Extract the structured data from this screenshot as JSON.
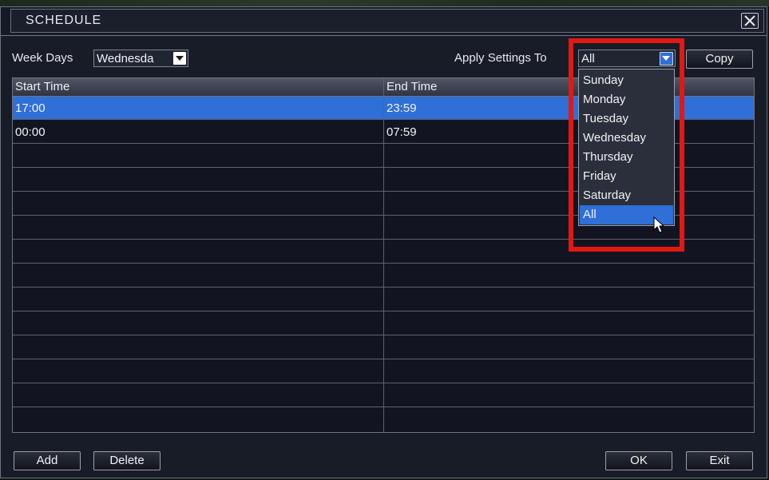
{
  "window": {
    "title": "SCHEDULE"
  },
  "controls": {
    "week_days_label": "Week Days",
    "week_days_value": "Wednesda",
    "apply_label": "Apply Settings To",
    "apply_value": "All",
    "copy_label": "Copy"
  },
  "table": {
    "headers": [
      "Start Time",
      "End Time"
    ],
    "rows": [
      {
        "start": "17:00",
        "end": "23:59",
        "selected": true
      },
      {
        "start": "00:00",
        "end": "07:59",
        "selected": false
      }
    ]
  },
  "dropdown": {
    "options": [
      "Sunday",
      "Monday",
      "Tuesday",
      "Wednesday",
      "Thursday",
      "Friday",
      "Saturday",
      "All"
    ],
    "active": "All"
  },
  "footer": {
    "add": "Add",
    "delete": "Delete",
    "ok": "OK",
    "exit": "Exit"
  },
  "colors": {
    "highlight": "#e01a12",
    "selection": "#2e6fd8"
  }
}
